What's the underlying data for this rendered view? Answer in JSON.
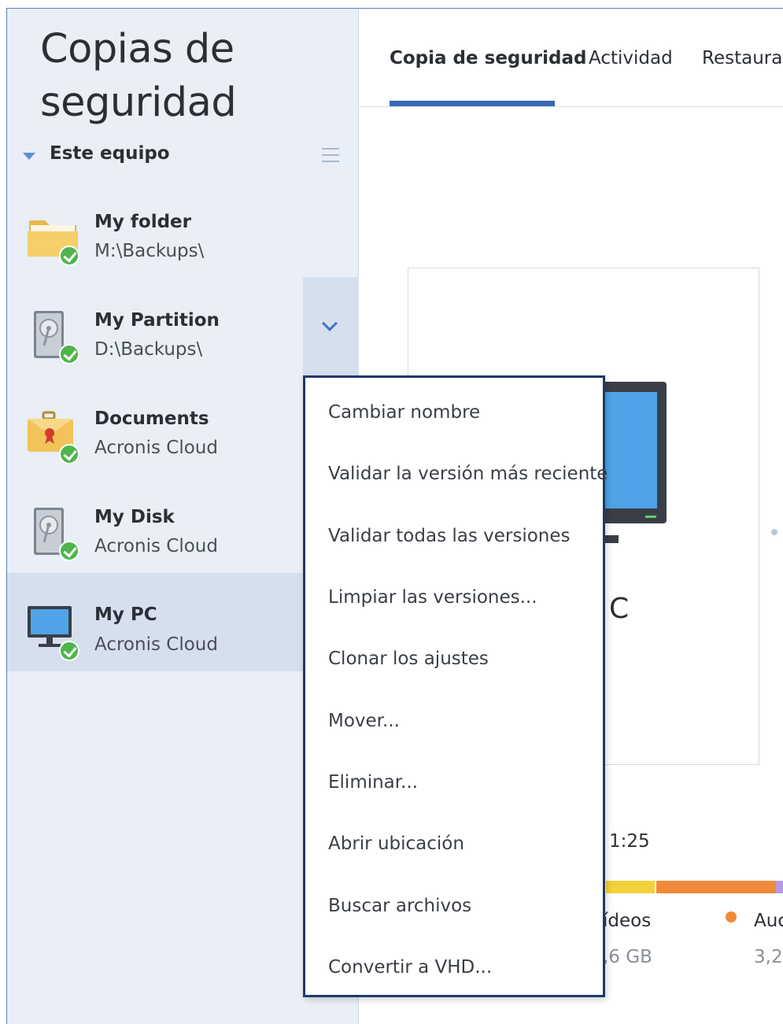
{
  "sidebar": {
    "title_line1": "Copias de",
    "title_line2": "seguridad",
    "group_label": "Este equipo",
    "items": [
      {
        "name": "My folder",
        "location": "M:\\Backups\\",
        "icon": "folder-icon",
        "status": "ok"
      },
      {
        "name": "My Partition",
        "location": "D:\\Backups\\",
        "icon": "hard-drive-icon",
        "status": "ok"
      },
      {
        "name": "Documents",
        "location": "Acronis Cloud",
        "icon": "document-case-icon",
        "status": "ok"
      },
      {
        "name": "My Disk",
        "location": "Acronis Cloud",
        "icon": "hard-drive-icon",
        "status": "ok"
      },
      {
        "name": "My PC",
        "location": "Acronis Cloud",
        "icon": "monitor-icon",
        "status": "ok",
        "selected": true
      }
    ]
  },
  "tabs": [
    {
      "label": "Copia de seguridad",
      "active": true
    },
    {
      "label": "Actividad",
      "active": false
    },
    {
      "label": "Restaurar",
      "active": false
    }
  ],
  "context_menu": {
    "items": [
      "Cambiar nombre",
      "Validar la versión más reciente",
      "Validar todas las versiones",
      "Limpiar las versiones...",
      "Clonar los ajustes",
      "Mover...",
      "Eliminar...",
      "Abrir ubicación",
      "Buscar archivos",
      "Convertir a VHD..."
    ]
  },
  "main": {
    "card_title_fragment": "C",
    "time_fragment": "1:25",
    "legend": [
      {
        "label": "ídeos",
        "size": ",6 GB",
        "color": "#f2d13a"
      },
      {
        "label": "Auc",
        "size": "3,2",
        "color": "#f08a3a"
      }
    ]
  },
  "colors": {
    "accent": "#3a68b4",
    "sidebar_bg": "#e9eef7",
    "selected_bg": "#d6dfee",
    "status_ok": "#4fb54b",
    "menu_border": "#1f3a66"
  }
}
